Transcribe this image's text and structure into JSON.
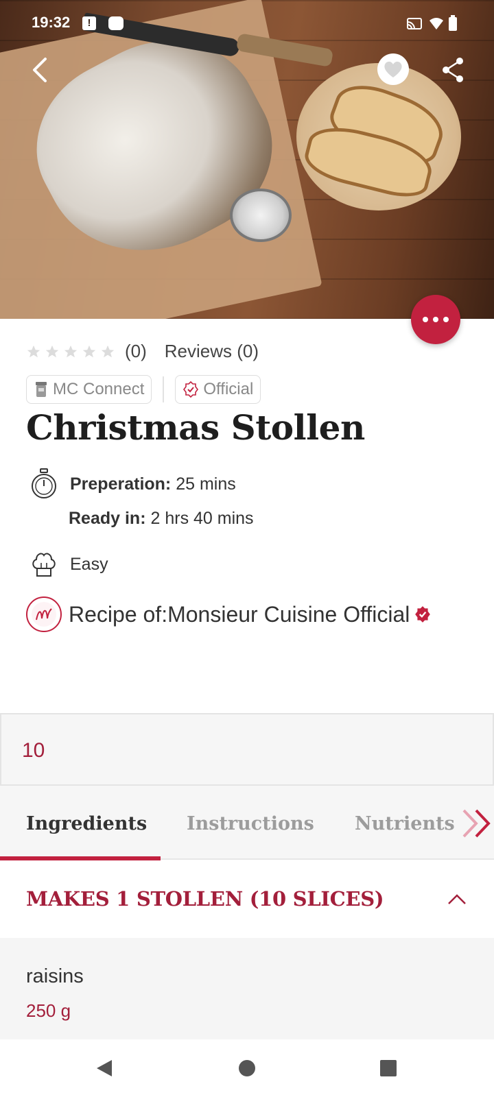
{
  "status_bar": {
    "time": "19:32",
    "notification_glyph": "!"
  },
  "hero": {
    "image_alt": "Christmas stollen dusted with powdered sugar next to sliced stollen on a wooden board",
    "icons": [
      "back-arrow-icon",
      "heart-icon",
      "share-icon",
      "more-dots-icon"
    ]
  },
  "rating": {
    "stars_filled": 0,
    "stars_total": 5,
    "count_text": "(0)",
    "reviews_text": "Reviews (0)"
  },
  "tags": [
    {
      "label": "MC Connect",
      "icon": "device-icon"
    },
    {
      "label": "Official",
      "icon": "verified-badge-icon"
    }
  ],
  "recipe": {
    "title": "Christmas Stollen",
    "prep_label": "Preperation:",
    "prep_value": "25 mins",
    "ready_label": "Ready in:",
    "ready_value": "2 hrs 40 mins",
    "difficulty": "Easy",
    "author_text": "Recipe of:Monsieur Cuisine Official"
  },
  "servings": {
    "value": "10"
  },
  "tabs": [
    {
      "label": "Ingredients",
      "active": true
    },
    {
      "label": "Instructions",
      "active": false
    },
    {
      "label": "Nutrients",
      "active": false
    }
  ],
  "section": {
    "title": "MAKES 1 STOLLEN (10 SLICES)"
  },
  "ingredients": [
    {
      "name": "raisins",
      "quantity": "250 g"
    }
  ],
  "colors": {
    "accent": "#c2213f",
    "accent_text": "#a31f3b",
    "panel_bg": "#f6f6f6"
  }
}
